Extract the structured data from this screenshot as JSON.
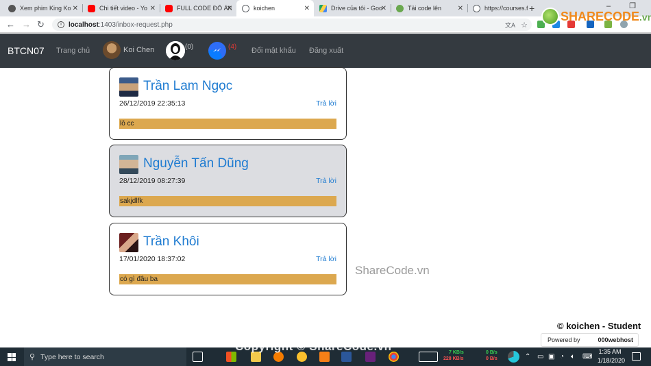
{
  "browser": {
    "tabs": [
      {
        "label": "Xem phim King Ko",
        "icon": "github-icon",
        "color": "#555555"
      },
      {
        "label": "Chi tiết video - Yo",
        "icon": "youtube-icon",
        "color": "#ff0000"
      },
      {
        "label": "FULL CODE ĐỒ ÁN",
        "icon": "youtube-icon",
        "color": "#ff0000"
      },
      {
        "label": "koichen",
        "icon": "globe-icon",
        "color": "#5f6368",
        "active": true
      },
      {
        "label": "Drive của tôi - Goo",
        "icon": "drive-icon",
        "color": "#1fa463"
      },
      {
        "label": "Tải code lên",
        "icon": "sharecode-icon",
        "color": "#6aa84f"
      },
      {
        "label": "https://courses.fit.",
        "icon": "globe-icon",
        "color": "#5f6368"
      }
    ],
    "address_host": "localhost",
    "address_path": ":1403/inbox-request.php"
  },
  "site": {
    "brand": "BTCN07",
    "nav_home": "Trang chủ",
    "user_name": "Koi Chen",
    "friend_requests": "(0)",
    "messages_count": "(4)",
    "change_password": "Đổi mật khẩu",
    "logout": "Đăng xuất"
  },
  "messages": [
    {
      "name": "Trần Lam Ngọc",
      "date": "26/12/2019 22:35:13",
      "reply": "Trả lời",
      "text": "lô cc",
      "highlighted": false
    },
    {
      "name": "Nguyễn Tấn Dũng",
      "date": "28/12/2019 08:27:39",
      "reply": "Trả lời",
      "text": "sakjdlfk",
      "highlighted": true
    },
    {
      "name": "Trần Khôi",
      "date": "17/01/2020 18:37:02",
      "reply": "Trả lời",
      "text": "có gì đâu ba",
      "highlighted": false
    }
  ],
  "watermark": "ShareCode.vn",
  "footer_credit": "© koichen - Student",
  "powered_by": "Powered by",
  "powered_brand": "000webhost",
  "sharecode_logo": {
    "main": "SHARECODE",
    "suffix": ".vn"
  },
  "copyright_overlay": "Copyright © ShareCode.vn",
  "taskbar": {
    "search_placeholder": "Type here to search",
    "net_up": "7 KB/s",
    "net_down": "228 KB/s",
    "net2_up": "0 B/s",
    "net2_down": "0 B/s",
    "time": "1:35 AM",
    "date": "1/18/2020"
  },
  "colors": {
    "navbar": "#343a40",
    "link_blue": "#1e7bd1",
    "message_bg": "#dca84f",
    "highlight_card": "#dcdde1"
  }
}
